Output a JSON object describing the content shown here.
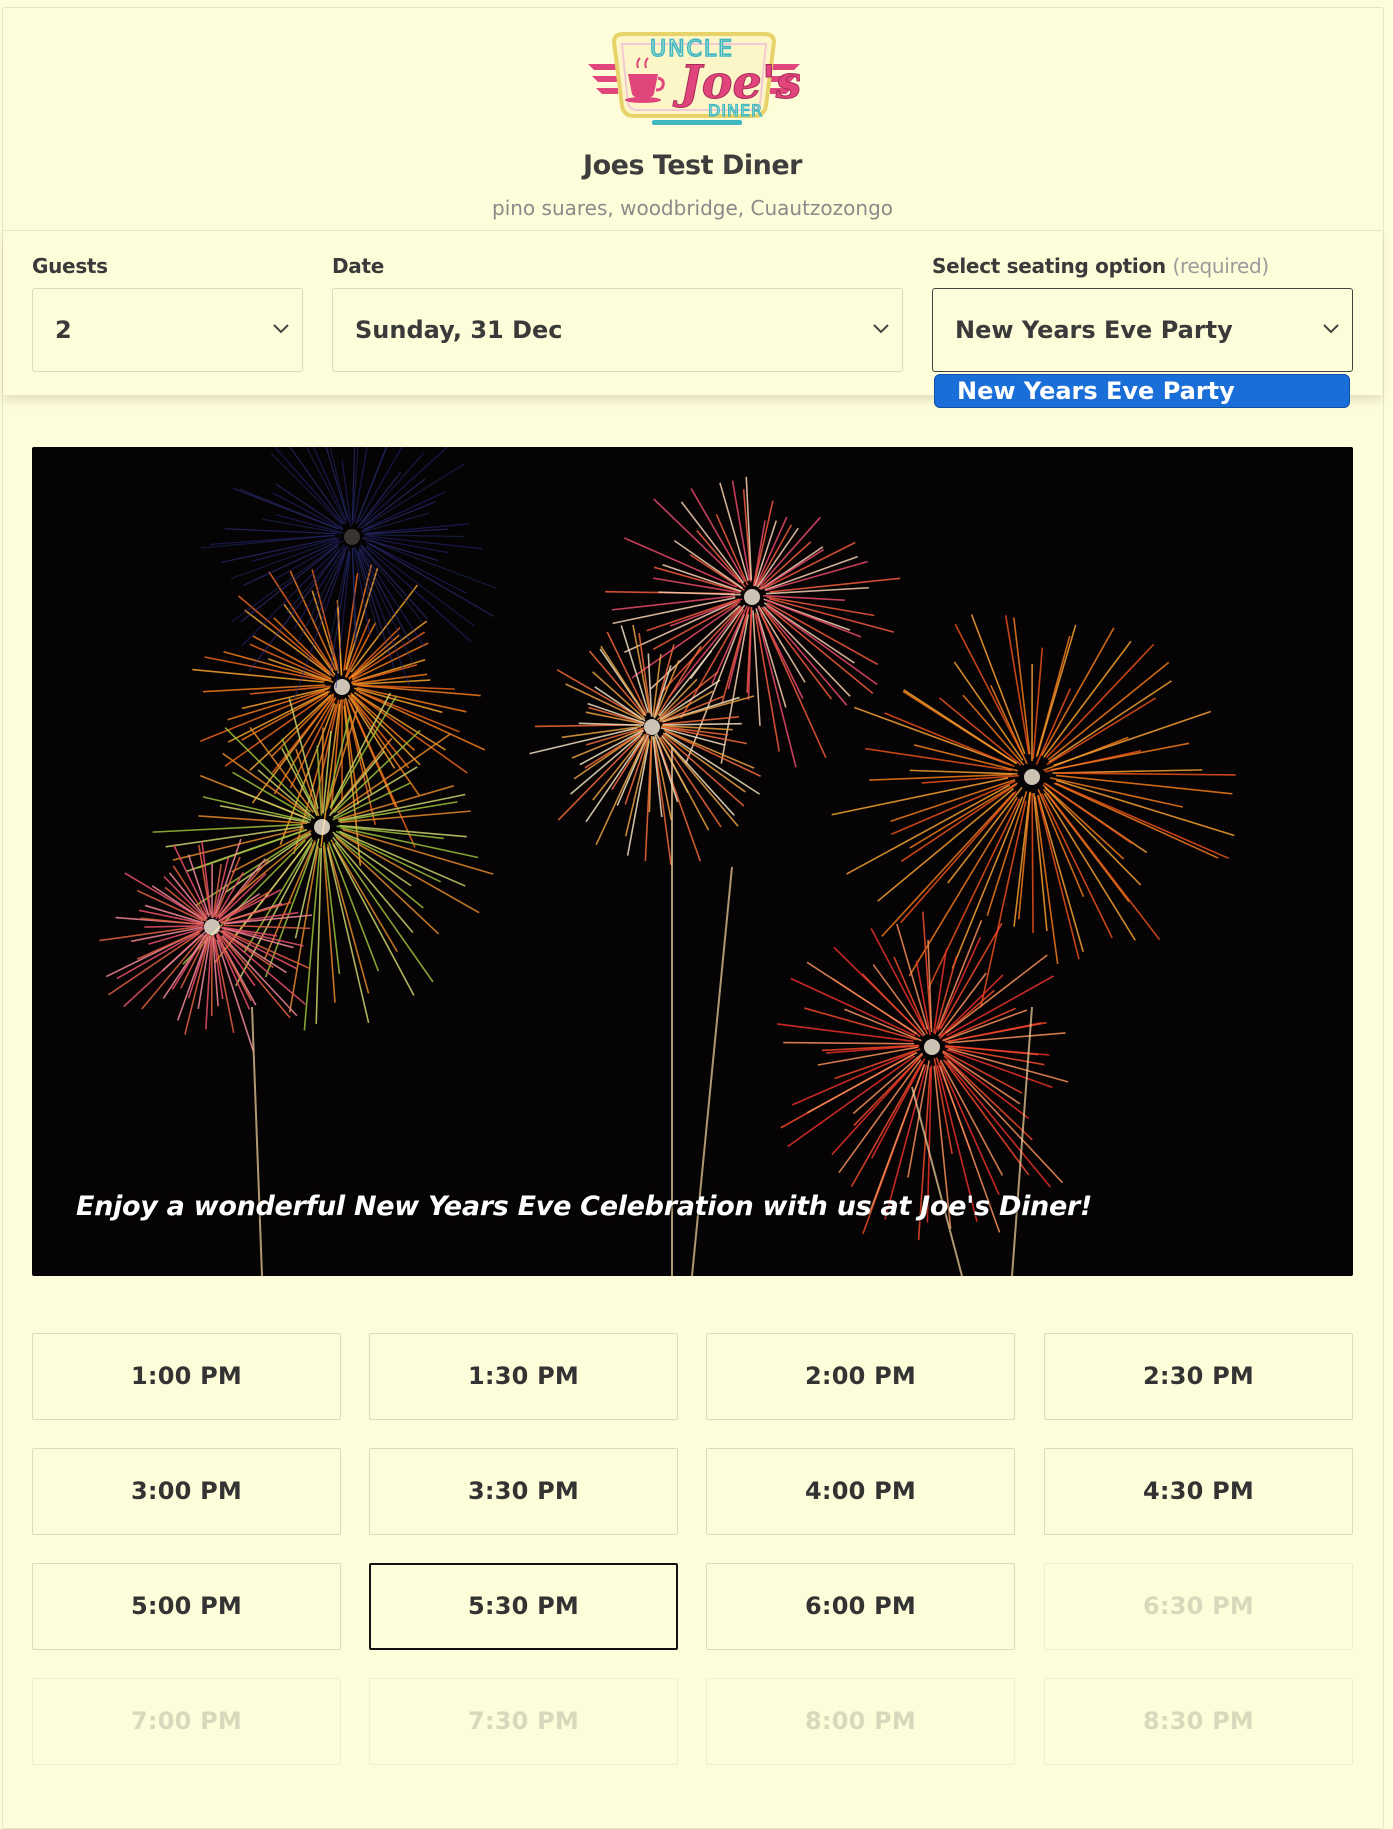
{
  "header": {
    "logo_lines": [
      "UNCLE",
      "Joe's",
      "DINER"
    ],
    "restaurant_name": "Joes Test Diner",
    "address": "pino suares, woodbridge, Cuautzozongo"
  },
  "filters": {
    "guests": {
      "label": "Guests",
      "value": "2"
    },
    "date": {
      "label": "Date",
      "value": "Sunday, 31 Dec"
    },
    "seating": {
      "label": "Select seating option",
      "required_note": "(required)",
      "value": "New Years Eve Party",
      "options": [
        "New Years Eve Party"
      ],
      "highlighted_option": "New Years Eve Party"
    }
  },
  "hero": {
    "caption": "Enjoy a wonderful New Years Eve Celebration with us at Joe's Diner!"
  },
  "time_slots": [
    {
      "label": "1:00 PM",
      "state": "available"
    },
    {
      "label": "1:30 PM",
      "state": "available"
    },
    {
      "label": "2:00 PM",
      "state": "available"
    },
    {
      "label": "2:30 PM",
      "state": "available"
    },
    {
      "label": "3:00 PM",
      "state": "available"
    },
    {
      "label": "3:30 PM",
      "state": "available"
    },
    {
      "label": "4:00 PM",
      "state": "available"
    },
    {
      "label": "4:30 PM",
      "state": "available"
    },
    {
      "label": "5:00 PM",
      "state": "available"
    },
    {
      "label": "5:30 PM",
      "state": "selected"
    },
    {
      "label": "6:00 PM",
      "state": "available"
    },
    {
      "label": "6:30 PM",
      "state": "disabled"
    },
    {
      "label": "7:00 PM",
      "state": "disabled"
    },
    {
      "label": "7:30 PM",
      "state": "disabled"
    },
    {
      "label": "8:00 PM",
      "state": "disabled"
    },
    {
      "label": "8:30 PM",
      "state": "disabled"
    }
  ],
  "colors": {
    "background": "#fefdd9",
    "highlight": "#1a6ed8",
    "text": "#333333",
    "muted": "#8a8a8a",
    "logo_pink": "#e0457b",
    "logo_teal": "#3fb8c4"
  },
  "icons": {
    "dropdown": "chevron-down-icon",
    "logo_cup": "coffee-cup-icon"
  }
}
